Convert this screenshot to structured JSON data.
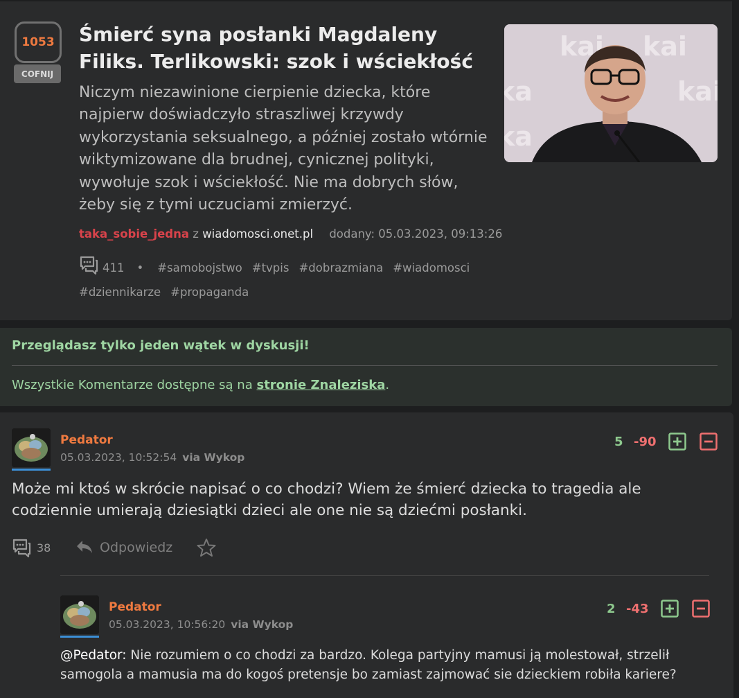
{
  "article": {
    "votes": "1053",
    "undo_label": "COFNIJ",
    "title": "Śmierć syna posłanki Magdaleny Filiks. Terlikowski: szok i wściekłość",
    "lead": "Niczym niezawinione cierpienie dziecka, które najpierw doświadczyło straszliwej krzywdy wykorzystania seksualnego, a później zostało wtórnie wiktymizowane dla brudnej, cynicznej polityki, wywołuje szok i wściekłość. Nie ma dobrych słów, żeby się z tymi uczuciami zmierzyć.",
    "author": "taka_sobie_jedna",
    "from_word": "z",
    "source": "wiadomosci.onet.pl",
    "added": "dodany: 05.03.2023, 09:13:26",
    "comment_count": "411",
    "dot": "•",
    "tags": [
      "#samobojstwo",
      "#tvpis",
      "#dobrazmiana",
      "#wiadomosci",
      "#dziennikarze",
      "#propaganda"
    ],
    "thumb_text": [
      "kai",
      "kai",
      "ka",
      "kai",
      "ka"
    ]
  },
  "notice": {
    "title": "Przeglądasz tylko jeden wątek w dyskusji!",
    "text_before": "Wszystkie Komentarze dostępne są na ",
    "link": "stronie Znaleziska",
    "text_after": "."
  },
  "comment": {
    "user": "Pedator",
    "date": "05.03.2023, 10:52:54",
    "via": "via Wykop",
    "plus": "5",
    "minus": "-90",
    "text": "Może mi ktoś w skrócie napisać o co chodzi? Wiem że śmierć dziecka to tragedia ale codziennie umierają dziesiątki dzieci ale one nie są dziećmi posłanki.",
    "replies_count": "38",
    "reply_label": "Odpowiedz"
  },
  "reply": {
    "user": "Pedator",
    "date": "05.03.2023, 10:56:20",
    "via": "via Wykop",
    "plus": "2",
    "minus": "-43",
    "mention": "@Pedator:",
    "text": " Nie rozumiem o co chodzi za bardzo. Kolega partyjny mamusi ją molestował, strzelił samogola a mamusia ma do kogoś pretensje bo zamiast zajmować sie dzieckiem robiła kariere?"
  },
  "colors": {
    "accent_orange": "#ef7a40",
    "author_red": "#d9434b",
    "notice_green": "#9fd6a3",
    "plus_green": "#8ec98e",
    "minus_red": "#ef7070"
  }
}
